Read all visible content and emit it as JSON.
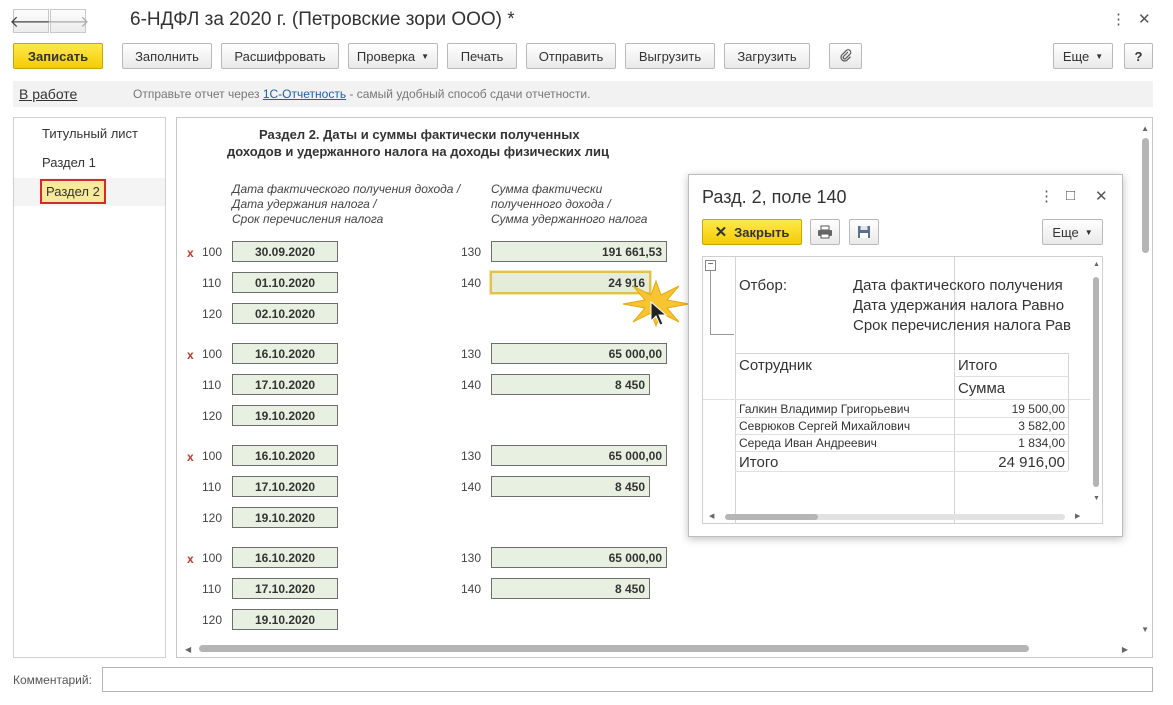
{
  "window": {
    "title": "6-НДФЛ за 2020 г. (Петровские зори ООО) *",
    "back_icon": "arrow-left-icon",
    "forward_icon": "arrow-right-icon",
    "menu_icon": "kebab-menu-icon",
    "close_icon": "close-icon"
  },
  "toolbar": {
    "save_label": "Записать",
    "fill_label": "Заполнить",
    "decode_label": "Расшифровать",
    "check_label": "Проверка",
    "print_label": "Печать",
    "send_label": "Отправить",
    "export_label": "Выгрузить",
    "import_label": "Загрузить",
    "attach_icon": "paperclip-icon",
    "more_label": "Еще",
    "help_label": "?"
  },
  "info": {
    "status": "В работе",
    "text_before": "Отправьте отчет через ",
    "link": "1С-Отчетность",
    "text_after": " - самый удобный способ сдачи отчетности."
  },
  "sidebar": {
    "items": [
      {
        "label": "Титульный лист"
      },
      {
        "label": "Раздел 1"
      },
      {
        "label": "Раздел 2"
      }
    ]
  },
  "section2": {
    "title_line1": "Раздел 2.  Даты и суммы фактически полученных",
    "title_line2": "доходов и удержанного налога на доходы физических лиц",
    "col_dates_line1": "Дата фактического получения дохода /",
    "col_dates_line2": "Дата удержания налога /",
    "col_dates_line3": "Срок перечисления налога",
    "col_sums_line1": "Сумма фактически",
    "col_sums_line2": "полученного дохода /",
    "col_sums_line3": "Сумма удержанного налога",
    "blocks": [
      {
        "x": "x",
        "c100": "100",
        "c110": "110",
        "c120": "120",
        "c130": "130",
        "c140": "140",
        "d100": "30.09.2020",
        "d110": "01.10.2020",
        "d120": "02.10.2020",
        "s130": "191 661,53",
        "s140": "24 916"
      },
      {
        "x": "x",
        "c100": "100",
        "c110": "110",
        "c120": "120",
        "c130": "130",
        "c140": "140",
        "d100": "16.10.2020",
        "d110": "17.10.2020",
        "d120": "19.10.2020",
        "s130": "65 000,00",
        "s140": "8 450"
      },
      {
        "x": "x",
        "c100": "100",
        "c110": "110",
        "c120": "120",
        "c130": "130",
        "c140": "140",
        "d100": "16.10.2020",
        "d110": "17.10.2020",
        "d120": "19.10.2020",
        "s130": "65 000,00",
        "s140": "8 450"
      },
      {
        "x": "x",
        "c100": "100",
        "c110": "110",
        "c120": "120",
        "c130": "130",
        "c140": "140",
        "d100": "16.10.2020",
        "d110": "17.10.2020",
        "d120": "19.10.2020",
        "s130": "65 000,00",
        "s140": "8 450"
      }
    ]
  },
  "popup": {
    "title": "Разд. 2, поле 140",
    "close_label": "Закрыть",
    "more_label": "Еще",
    "print_icon": "printer-icon",
    "save_icon": "floppy-disk-icon",
    "filter_label": "Отбор:",
    "filter_line1": "Дата фактического получения",
    "filter_line2": "Дата удержания налога Равно",
    "filter_line3": "Срок перечисления налога Рав",
    "head_employee": "Сотрудник",
    "head_total": "Итого",
    "head_sum": "Сумма",
    "rows": [
      {
        "name": "Галкин Владимир Григорьевич",
        "sum": "19 500,00"
      },
      {
        "name": "Севрюков Сергей Михайлович",
        "sum": "3 582,00"
      },
      {
        "name": "Середа Иван Андреевич",
        "sum": "1 834,00"
      }
    ],
    "total_label": "Итого",
    "total_sum": "24 916,00",
    "collapse_icon": "minus-box-icon"
  },
  "comment": {
    "label": "Комментарий:",
    "value": ""
  }
}
